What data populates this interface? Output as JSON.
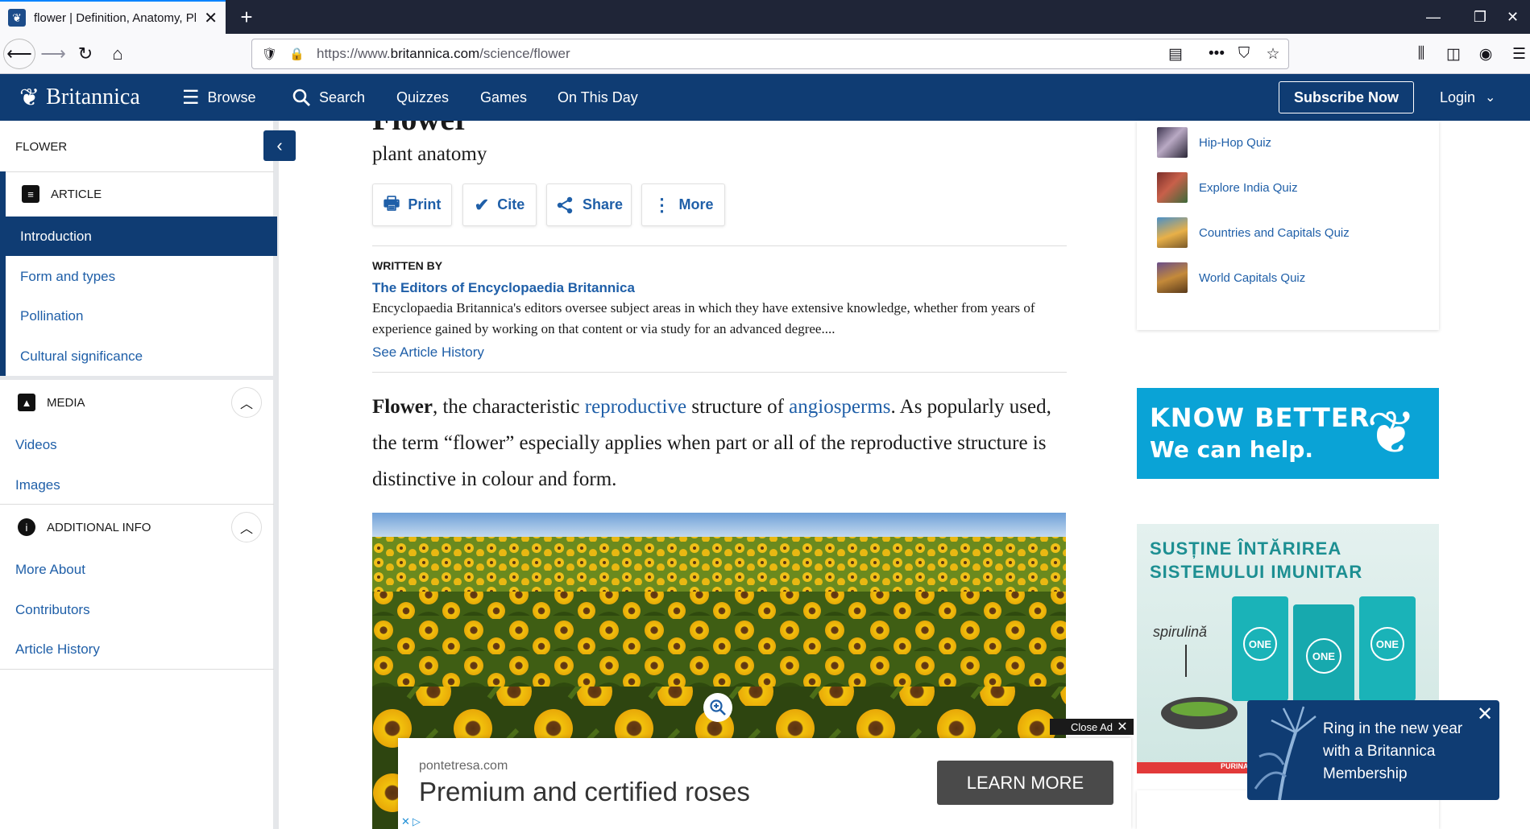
{
  "browser": {
    "tab_title": "flower | Definition, Anatomy, Pl",
    "url_prefix": "https://www.",
    "url_domain": "britannica.com",
    "url_path": "/science/flower"
  },
  "site": {
    "logo": "Britannica",
    "nav": {
      "browse": "Browse",
      "search": "Search",
      "quizzes": "Quizzes",
      "games": "Games",
      "on_this_day": "On This Day",
      "subscribe": "Subscribe Now",
      "login": "Login"
    }
  },
  "sidebar": {
    "topic": "FLOWER",
    "article_label": "ARTICLE",
    "sections": [
      "Introduction",
      "Form and types",
      "Pollination",
      "Cultural significance"
    ],
    "media_label": "MEDIA",
    "media_items": [
      "Videos",
      "Images"
    ],
    "additional_label": "ADDITIONAL INFO",
    "additional_items": [
      "More About",
      "Contributors",
      "Article History"
    ]
  },
  "article": {
    "title": "Flower",
    "subtitle": "plant anatomy",
    "tools": {
      "print": "Print",
      "cite": "Cite",
      "share": "Share",
      "more": "More"
    },
    "written_by_label": "WRITTEN BY",
    "author": "The Editors of Encyclopaedia Britannica",
    "author_desc": "Encyclopaedia Britannica's editors oversee subject areas in which they have extensive knowledge, whether from years of experience gained by working on that content or via study for an advanced degree....",
    "history_link": "See Article History",
    "lead_term": "Flower",
    "p1": ", the characteristic ",
    "link1": "reproductive",
    "p2": " structure of ",
    "link2": "angiosperms",
    "p3": ". As popularly used, the term “flower” especially applies when part or all of the reproductive structure is distinctive in colour and form."
  },
  "rail": {
    "quizzes": [
      "Hip-Hop Quiz",
      "Explore India Quiz",
      "Countries and Capitals Quiz",
      "World Capitals Quiz"
    ],
    "banner_line1": "KNOW BETTER",
    "banner_line2": "We can help.",
    "ad2_line1": "SUSȚINE ÎNTĂRIREA",
    "ad2_line2": "SISTEMULUI IMUNITAR",
    "ad2_spirulina": "spirulină",
    "ad2_bag_text": "ONE",
    "ad2_purina": "PURINA"
  },
  "membership_popup": {
    "text": "Ring in the new year with a Britannica Membership"
  },
  "bottom_ad": {
    "close_label": "Close Ad",
    "domain": "pontetresa.com",
    "headline": "Premium and certified roses",
    "cta": "LEARN MORE"
  },
  "colors": {
    "brand_navy": "#0f3c73",
    "link_blue": "#1f5fa8",
    "banner_cyan": "#0aa3d6"
  }
}
